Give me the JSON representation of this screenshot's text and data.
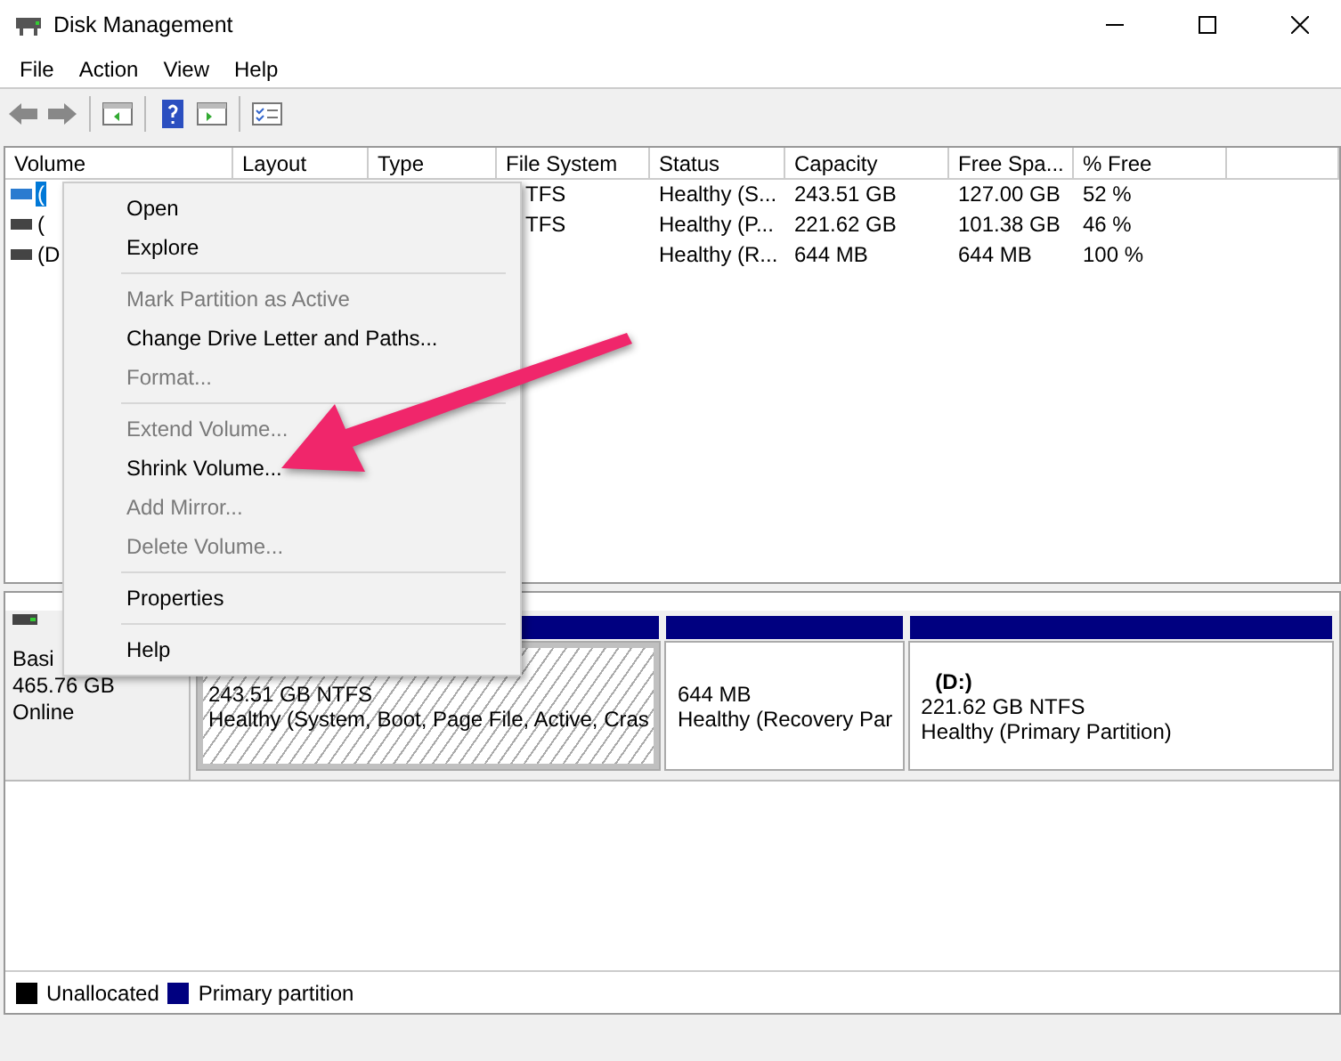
{
  "window": {
    "title": "Disk Management"
  },
  "menu_bar": [
    "File",
    "Action",
    "View",
    "Help"
  ],
  "table": {
    "columns": [
      "Volume",
      "Layout",
      "Type",
      "File System",
      "Status",
      "Capacity",
      "Free Spa...",
      "% Free"
    ],
    "rows": [
      {
        "selected": true,
        "cells": [
          "(",
          "",
          "",
          "TFS",
          "Healthy (S...",
          "243.51 GB",
          "127.00 GB",
          "52 %"
        ]
      },
      {
        "selected": false,
        "cells": [
          "(",
          "",
          "",
          "TFS",
          "Healthy (P...",
          "221.62 GB",
          "101.38 GB",
          "46 %"
        ]
      },
      {
        "selected": false,
        "cells": [
          "(D",
          "",
          "",
          "",
          "Healthy (R...",
          "644 MB",
          "644 MB",
          "100 %"
        ]
      }
    ]
  },
  "disk": {
    "lines": [
      "Basi",
      "465.76 GB",
      "Online"
    ],
    "partitions": [
      {
        "kind": "hatched",
        "lines": [
          "243.51 GB NTFS",
          "Healthy (System, Boot, Page File, Active, Cras"
        ]
      },
      {
        "kind": "plain",
        "lines": [
          "644 MB",
          "Healthy (Recovery Par"
        ]
      },
      {
        "kind": "plain",
        "name": "(D:)",
        "lines": [
          "221.62 GB NTFS",
          "Healthy (Primary Partition)"
        ]
      }
    ]
  },
  "legend": [
    {
      "label": "Unallocated",
      "color": "#000000"
    },
    {
      "label": "Primary partition",
      "color": "#000080"
    }
  ],
  "context_menu": [
    [
      {
        "label": "Open",
        "disabled": false
      },
      {
        "label": "Explore",
        "disabled": false
      }
    ],
    [
      {
        "label": "Mark Partition as Active",
        "disabled": true
      },
      {
        "label": "Change Drive Letter and Paths...",
        "disabled": false
      },
      {
        "label": "Format...",
        "disabled": true
      }
    ],
    [
      {
        "label": "Extend Volume...",
        "disabled": true
      },
      {
        "label": "Shrink Volume...",
        "disabled": false
      },
      {
        "label": "Add Mirror...",
        "disabled": true
      },
      {
        "label": "Delete Volume...",
        "disabled": true
      }
    ],
    [
      {
        "label": "Properties",
        "disabled": false
      }
    ],
    [
      {
        "label": "Help",
        "disabled": false
      }
    ]
  ]
}
